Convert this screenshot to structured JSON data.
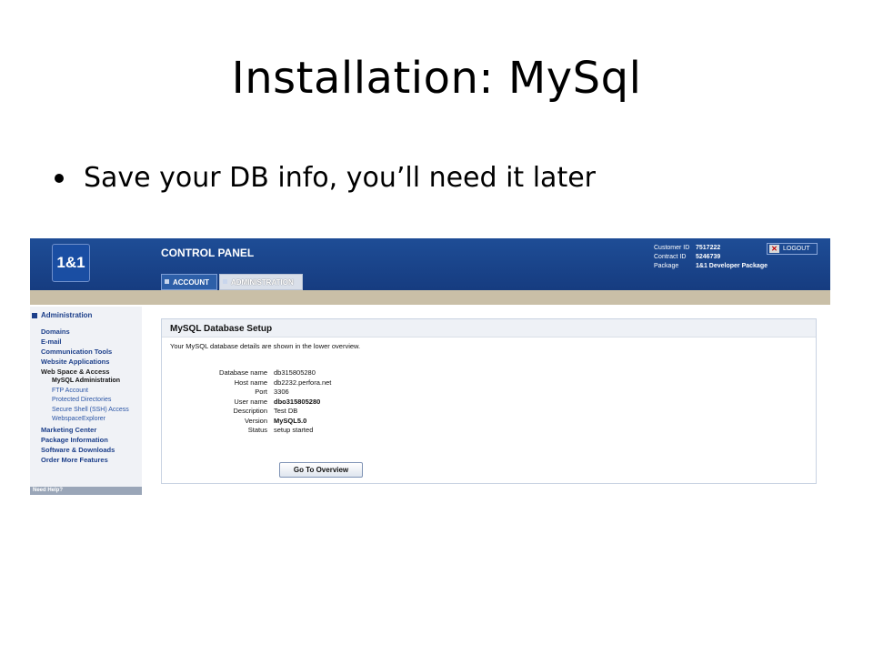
{
  "slide": {
    "title": "Installation: MySql",
    "bullet": "Save your DB info, you’ll need it later"
  },
  "screenshot": {
    "logo": "1&1",
    "header_title": "CONTROL PANEL",
    "tabs": [
      {
        "label": "ACCOUNT",
        "active": false
      },
      {
        "label": "ADMINISTRATION",
        "active": true
      }
    ],
    "customer": [
      {
        "label": "Customer ID",
        "value": "7517222"
      },
      {
        "label": "Contract ID",
        "value": "5246739"
      },
      {
        "label": "Package",
        "value": "1&1 Developer Package"
      }
    ],
    "logout_label": "LOGOUT",
    "sidebar": {
      "heading": "Administration",
      "items": [
        {
          "label": "Domains",
          "type": "main"
        },
        {
          "label": "E-mail",
          "type": "main"
        },
        {
          "label": "Communication Tools",
          "type": "main"
        },
        {
          "label": "Website Applications",
          "type": "main"
        },
        {
          "label": "Web Space & Access",
          "type": "main-dark"
        },
        {
          "label": "MySQL Administration",
          "type": "sub-current"
        },
        {
          "label": "FTP Account",
          "type": "sub"
        },
        {
          "label": "Protected Directories",
          "type": "sub"
        },
        {
          "label": "Secure Shell (SSH) Access",
          "type": "sub"
        },
        {
          "label": "WebspaceExplorer",
          "type": "sub"
        },
        {
          "label": "Marketing Center",
          "type": "main"
        },
        {
          "label": "Package Information",
          "type": "main"
        },
        {
          "label": "Software & Downloads",
          "type": "main"
        },
        {
          "label": "Order More Features",
          "type": "main"
        }
      ],
      "help": "Need Help?"
    },
    "panel": {
      "title": "MySQL Database Setup",
      "description": "Your MySQL database details are shown in the lower overview.",
      "details": [
        {
          "label": "Database name",
          "value": "db315805280",
          "bold": false
        },
        {
          "label": "Host name",
          "value": "db2232.perfora.net",
          "bold": false
        },
        {
          "label": "Port",
          "value": "3306",
          "bold": false
        },
        {
          "label": "User name",
          "value": "dbo315805280",
          "bold": true
        },
        {
          "label": "Description",
          "value": "Test DB",
          "bold": false
        },
        {
          "label": "Version",
          "value": "MySQL5.0",
          "bold": true
        },
        {
          "label": "Status",
          "value": "setup started",
          "bold": false
        }
      ],
      "button": "Go To Overview"
    },
    "colors": {
      "header_blue": "#1e4d96",
      "tan_bar": "#c9bfa7",
      "link_blue": "#1c3f8a"
    }
  }
}
